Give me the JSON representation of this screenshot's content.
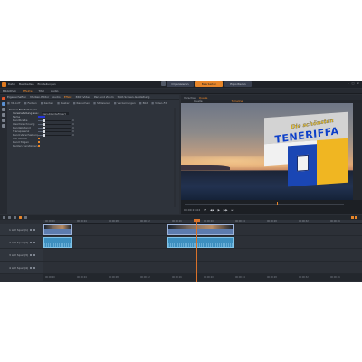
{
  "menu": {
    "items": [
      "Datei",
      "Bearbeiten",
      "Einstellungen"
    ],
    "window_controls": [
      "–",
      "□",
      "×"
    ]
  },
  "mode_tabs": [
    {
      "label": "Organisieren",
      "active": false
    },
    {
      "label": "Bearbeiten",
      "active": true
    },
    {
      "label": "Exportieren",
      "active": false
    }
  ],
  "library_tabs": [
    {
      "label": "Bibliothek",
      "active": false
    },
    {
      "label": "Effekte",
      "active": true
    },
    {
      "label": "Titel",
      "active": false
    },
    {
      "label": "Audio",
      "active": false
    }
  ],
  "panel_tabs": [
    {
      "label": "Eigenschaften",
      "active": false
    },
    {
      "label": "Medien-Editor",
      "active": false
    },
    {
      "label": "Audio",
      "active": false
    },
    {
      "label": "Effekt",
      "active": true
    },
    {
      "label": "360°-Video",
      "active": false
    },
    {
      "label": "Pan und Zoom",
      "active": false
    },
    {
      "label": "Split-Screen-Gestaltung",
      "active": false
    }
  ],
  "filters": [
    "3D-LUT",
    "Farben",
    "Kanten",
    "Raster",
    "Rauschen",
    "Stilisieren",
    "Verzerrungen",
    "Bild",
    "Video-FX"
  ],
  "effect": {
    "name": "Kontur-Einstellungen",
    "preset_label": "Voreinstellung aus:",
    "preset_value": "Benutzerdefiniert",
    "params": [
      {
        "label": "Farbe",
        "kind": "color"
      },
      {
        "label": "Randbreite",
        "kind": "slider",
        "value": 0.2,
        "num": "0"
      },
      {
        "label": "Weichzeichnung",
        "kind": "slider",
        "value": 0.2,
        "num": "0"
      },
      {
        "label": "Randabstand",
        "kind": "slider",
        "value": 0.2,
        "num": "0"
      },
      {
        "label": "Transparenz",
        "kind": "slider",
        "value": 0.2,
        "num": "0"
      },
      {
        "label": "Rand-Verschiebung",
        "kind": "slider",
        "value": 0.2,
        "num": "0"
      },
      {
        "label": "Nur Kontur",
        "kind": "check"
      },
      {
        "label": "Rand folgen",
        "kind": "check"
      },
      {
        "label": "Kanten verstärken",
        "kind": "check"
      }
    ]
  },
  "preview": {
    "tabs": [
      {
        "label": "Vorschau",
        "active": false
      },
      {
        "label": "Quelle",
        "active": true
      }
    ],
    "sub": [
      {
        "label": "Quelle",
        "active": false
      },
      {
        "label": "Timeline",
        "active": true
      }
    ],
    "title_line1": "Die schönsten",
    "title_line2": "TENERIFFA",
    "timecode": "00:00:19.02",
    "transport": [
      "⏮",
      "◀◀",
      "▶",
      "▶▶",
      "⏭"
    ],
    "playhead_fraction": 0.58
  },
  "timeline": {
    "ruler": [
      "00:00:00",
      "00:00:04",
      "00:00:08",
      "00:00:12",
      "00:00:16",
      "00:00:20",
      "00:00:24",
      "00:00:28",
      "00:00:32",
      "00:00:36"
    ],
    "tracks": [
      {
        "name": "1 A/V Spur (1)",
        "clips": [
          {
            "start": 0.0,
            "end": 0.09,
            "style": "blue"
          },
          {
            "start": 0.39,
            "end": 0.6,
            "style": "blue"
          }
        ]
      },
      {
        "name": "2 A/V Spur (2)",
        "clips": [
          {
            "start": 0.0,
            "end": 0.09,
            "style": "cyan"
          },
          {
            "start": 0.39,
            "end": 0.6,
            "style": "cyan"
          }
        ]
      },
      {
        "name": "3 A/V Spur (3)",
        "clips": []
      },
      {
        "name": "4 A/V Spur (4)",
        "clips": []
      }
    ],
    "playhead_fraction": 0.48
  }
}
